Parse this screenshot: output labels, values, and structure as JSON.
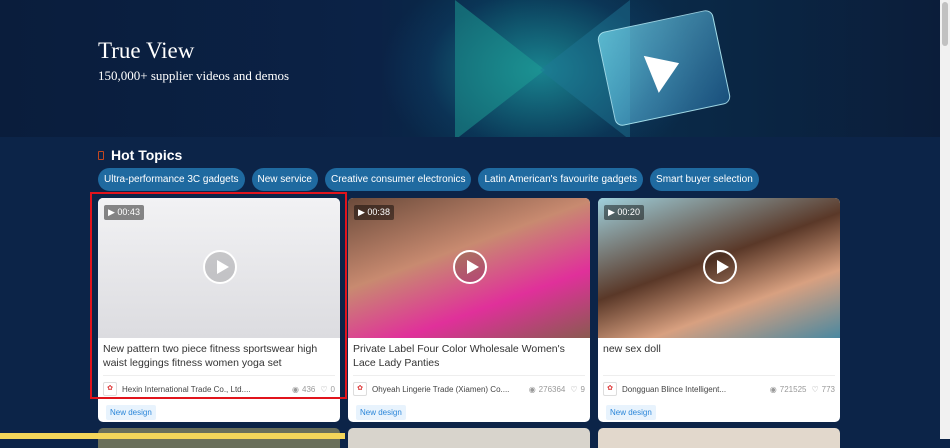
{
  "banner": {
    "title": "True View",
    "subtitle": "150,000+ supplier videos and demos"
  },
  "hot_topics": {
    "title": "Hot Topics",
    "chips": [
      "Ultra-performance 3C gadgets",
      "New service",
      "Creative consumer electronics",
      "Latin American's favourite gadgets",
      "Smart buyer selection"
    ]
  },
  "cards": [
    {
      "duration": "00:43",
      "title": "New pattern two piece fitness sportswear high waist leggings fitness women yoga set",
      "company": "Hexin International Trade Co., Ltd....",
      "views": "436",
      "likes": "0",
      "tag": "New design"
    },
    {
      "duration": "00:38",
      "title": "Private Label Four Color Wholesale Women's Lace Lady Panties",
      "company": "Ohyeah Lingerie Trade (Xiamen) Co....",
      "views": "276364",
      "likes": "9",
      "tag": "New design"
    },
    {
      "duration": "00:20",
      "title": "new sex doll",
      "company": "Dongguan Blince Intelligent...",
      "views": "721525",
      "likes": "773",
      "tag": "New design"
    }
  ],
  "colors": {
    "accent": "#1f6aa0",
    "selection": "#e1141c",
    "background": "#0c2448"
  }
}
